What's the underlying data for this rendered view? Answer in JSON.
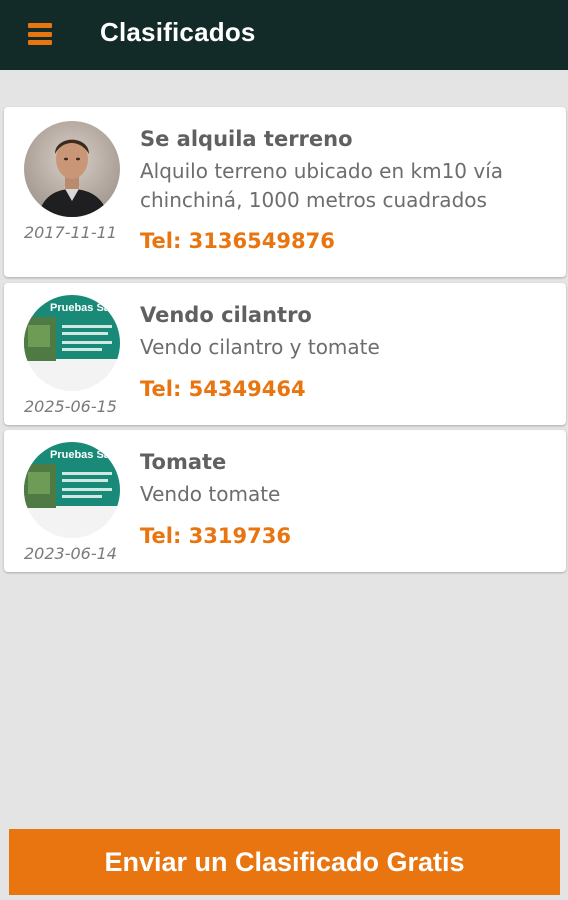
{
  "app": {
    "title": "Clasificados"
  },
  "listings": [
    {
      "title": "Se alquila terreno",
      "description": "Alquilo terreno ubicado en km10 vía chinchiná, 1000 metros cuadrados",
      "phone": "Tel: 3136549876",
      "date": "2017-11-11",
      "image": "person-photo"
    },
    {
      "title": "Vendo cilantro",
      "description": "Vendo cilantro y tomate",
      "phone": "Tel: 54349464",
      "date": "2025-06-15",
      "image": "flyer-thumbnail",
      "image_text": "Pruebas Sac"
    },
    {
      "title": "Tomate",
      "description": "Vendo tomate",
      "phone": "Tel: 3319736",
      "date": "2023-06-14",
      "image": "flyer-thumbnail",
      "image_text": "Pruebas Sac"
    }
  ],
  "cta": {
    "label": "Enviar un Clasificado Gratis"
  },
  "colors": {
    "appbar": "#132b28",
    "accent": "#e8750f",
    "background": "#e4e4e4",
    "flyer": "#1a8a78"
  }
}
